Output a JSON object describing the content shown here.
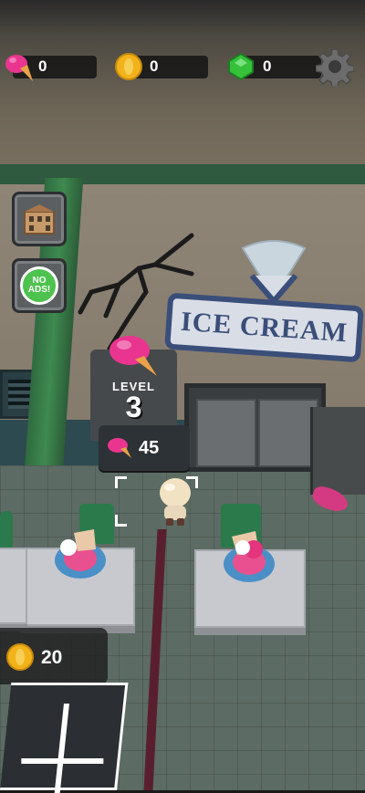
{
  "hud": {
    "icecream_count": "0",
    "coin_count": "0",
    "gem_count": "0",
    "icons": {
      "icecream": "pink-icecream-icon",
      "coin": "gold-coin-icon",
      "gem": "green-gem-icon",
      "settings": "gear-icon"
    }
  },
  "side_buttons": {
    "shop_icon": "building-icon",
    "no_ads_line1": "NO",
    "no_ads_line2": "ADS!"
  },
  "sign": {
    "text": "ICE CREAM"
  },
  "level": {
    "label": "LEVEL",
    "number": "3",
    "cost": "45"
  },
  "wallet": {
    "coins": "20"
  },
  "colors": {
    "icecream_pink": "#e9358f",
    "coin_gold": "#f2b21a",
    "gem_green": "#35c23a",
    "sign_blue": "#3a4e7a",
    "pillar_green": "#3e8a50"
  }
}
